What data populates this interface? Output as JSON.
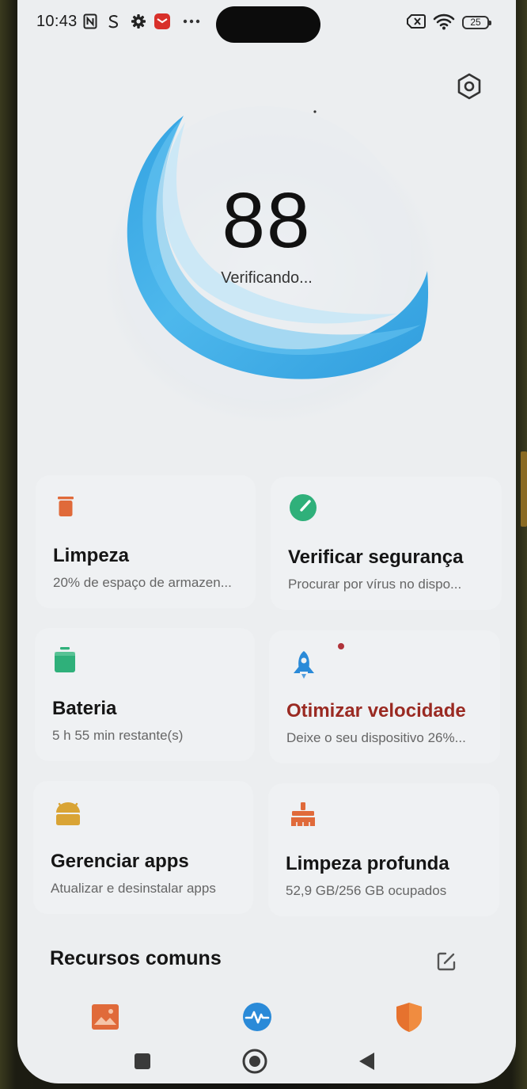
{
  "status_bar": {
    "time": "10:43",
    "battery_level": "25",
    "icons": [
      "nfc-icon",
      "data-saver-icon",
      "settings-gear-icon",
      "mail-app-icon",
      "more-dots-icon",
      "sim-x-icon",
      "wifi-icon",
      "battery-icon"
    ]
  },
  "header": {
    "settings_icon": "hexagon-settings-icon"
  },
  "score": {
    "value": "88",
    "status": "Verificando..."
  },
  "cards": {
    "limpeza": {
      "icon": "trash-bin-icon",
      "title": "Limpeza",
      "subtitle": "20% de espaço de armazen..."
    },
    "verificar_seguranca": {
      "icon": "security-check-icon",
      "title": "Verificar segurança",
      "subtitle": "Procurar por vírus no dispo..."
    },
    "bateria": {
      "icon": "battery-icon",
      "title": "Bateria",
      "subtitle": "5 h 55 min  restante(s)"
    },
    "otimizar_velocidade": {
      "icon": "rocket-icon",
      "title": "Otimizar velocidade",
      "subtitle": "Deixe o seu dispositivo 26%..."
    },
    "gerenciar_apps": {
      "icon": "android-apps-icon",
      "title": "Gerenciar apps",
      "subtitle": "Atualizar e desinstalar apps"
    },
    "limpeza_profunda": {
      "icon": "broom-brush-icon",
      "title": "Limpeza profunda",
      "subtitle": "52,9 GB/256 GB ocupados"
    }
  },
  "common_resources": {
    "title": "Recursos comuns",
    "edit_icon": "edit-icon"
  },
  "colors": {
    "orange": "#e06a3a",
    "green": "#2fb07a",
    "blue": "#2a8ad8",
    "yellow": "#d9a435",
    "warn_red": "#9a2a22",
    "orb_blue": "#2aa3e6"
  },
  "bottom_tabs": [
    "gallery-icon",
    "pulse-monitor-icon",
    "shield-icon"
  ],
  "nav_bar": [
    "recents-square-icon",
    "home-circle-icon",
    "back-triangle-icon"
  ]
}
